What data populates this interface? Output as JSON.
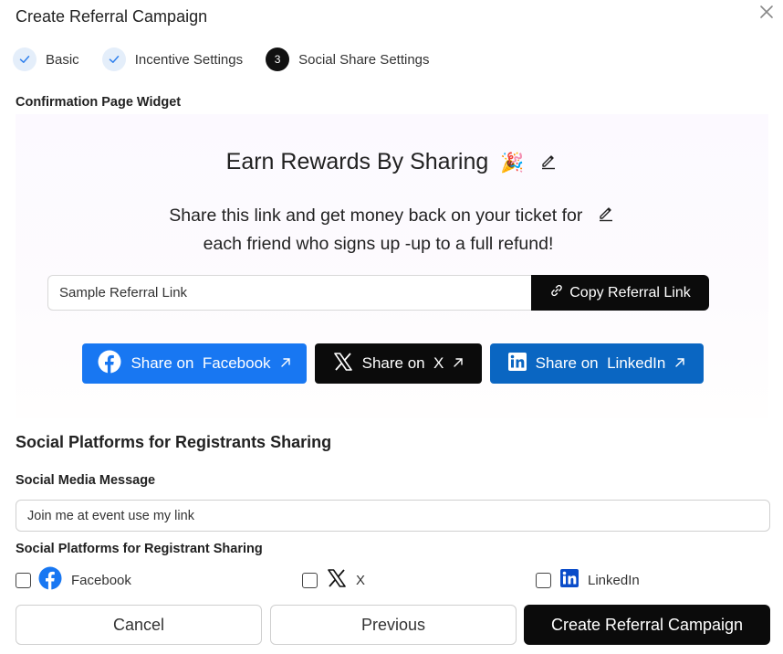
{
  "dialog": {
    "title": "Create Referral Campaign"
  },
  "steps": [
    {
      "label": "Basic",
      "state": "done"
    },
    {
      "label": "Incentive Settings",
      "state": "done"
    },
    {
      "label": "Social Share Settings",
      "state": "active",
      "number": "3"
    }
  ],
  "widget_section": {
    "label": "Confirmation Page Widget"
  },
  "widget": {
    "title": "Earn Rewards By Sharing",
    "title_emoji": "🎉",
    "desc_line1": "Share this link and get money back on your ticket for",
    "desc_line2": "each friend who signs up -up to a full refund!",
    "referral_link_value": "Sample Referral Link",
    "copy_button": "Copy Referral Link",
    "share_facebook": "Share on  Facebook",
    "share_x": "Share on  X",
    "share_linkedin": "Share on  LinkedIn"
  },
  "social": {
    "heading": "Social Platforms for Registrants Sharing",
    "message_label": "Social Media Message",
    "message_value": "Join me at event use my link",
    "platforms_label": "Social Platforms for Registrant Sharing",
    "platforms": [
      {
        "label": "Facebook",
        "checked": false,
        "icon": "facebook-icon"
      },
      {
        "label": "X",
        "checked": false,
        "icon": "x-icon"
      },
      {
        "label": "LinkedIn",
        "checked": false,
        "icon": "linkedin-icon"
      }
    ]
  },
  "footer": {
    "cancel": "Cancel",
    "previous": "Previous",
    "create": "Create Referral Campaign"
  },
  "colors": {
    "facebook": "#1877f2",
    "linkedin": "#0a66c2",
    "x": "#0b0b0b",
    "step_done_bg": "#e4eefa",
    "step_check": "#2f80ed"
  }
}
